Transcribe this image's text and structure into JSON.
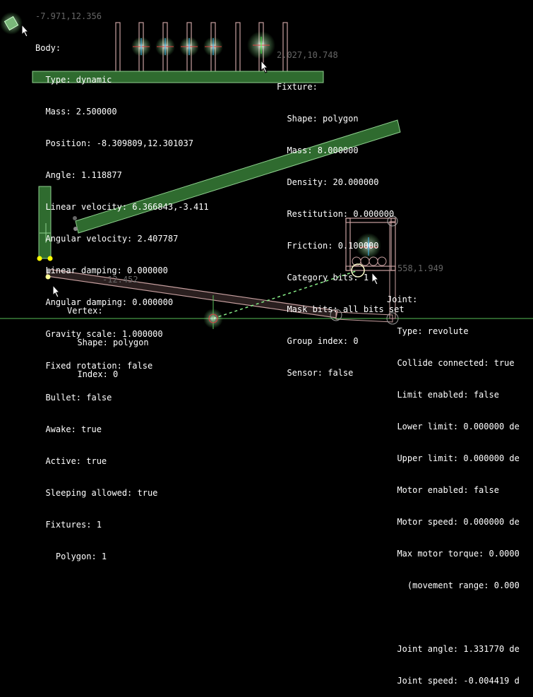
{
  "coords": {
    "body_anchor": "-7.971,12.356",
    "fixture_anchor": "2.027,10.748",
    "joint_anchor": "558,1.949",
    "vertex_anchor": "-12.452"
  },
  "body_panel": {
    "lines": [
      "Body:",
      "  Type: dynamic",
      "  Mass: 2.500000",
      "  Position: -8.309809,12.301037",
      "  Angle: 1.118877",
      "  Linear velocity: 6.366843,-3.411",
      "  Angular velocity: 2.407787",
      "  Linear damping: 0.000000",
      "  Angular damping: 0.000000",
      "  Gravity scale: 1.000000",
      "  Fixed rotation: false",
      "  Bullet: false",
      "  Awake: true",
      "  Active: true",
      "  Sleeping allowed: true",
      "  Fixtures: 1",
      "    Polygon: 1"
    ]
  },
  "fixture_panel": {
    "lines": [
      "Fixture:",
      "  Shape: polygon",
      "  Mass: 8.000000",
      "  Density: 20.000000",
      "  Restitution: 0.000000",
      "  Friction: 0.100000",
      "  Category bits: 1",
      "  Mask bits: all bits set",
      "  Group index: 0",
      "  Sensor: false"
    ]
  },
  "vertex_panel": {
    "lines": [
      "Vertex:",
      "  Shape: polygon",
      "  Index: 0"
    ]
  },
  "joint_panel": {
    "lines": [
      "Joint:",
      "  Type: revolute",
      "  Collide connected: true",
      "  Limit enabled: false",
      "  Lower limit: 0.000000 de",
      "  Upper limit: 0.000000 de",
      "  Motor enabled: false",
      "  Motor speed: 0.000000 de",
      "  Max motor torque: 0.0000",
      "    (movement range: 0.000",
      "",
      "  Joint angle: 1.331770 de",
      "  Joint speed: -0.004419 d"
    ]
  },
  "colors": {
    "body_fill": "#2f6b2f",
    "body_stroke": "#8fd08f",
    "static_stroke": "#c8a0a0",
    "ground": "#58c058",
    "text": "#ffffff",
    "coord_text": "#666666",
    "vertex_dot": "#ffff00"
  },
  "icons": [
    "mouse-cursor-icon",
    "selected-body-icon",
    "joint-anchor-icon"
  ]
}
